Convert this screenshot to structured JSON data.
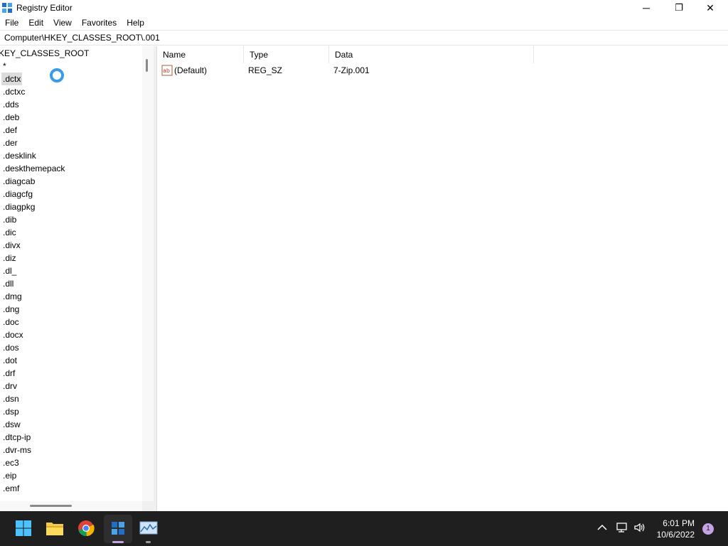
{
  "window": {
    "title": "Registry Editor",
    "icon": "registry-editor-icon",
    "controls": {
      "minimize": "─",
      "maximize": "❐",
      "close": "✕"
    }
  },
  "menu": {
    "items": [
      "File",
      "Edit",
      "View",
      "Favorites",
      "Help"
    ]
  },
  "address": {
    "path": "Computer\\HKEY_CLASSES_ROOT\\.001"
  },
  "tree": {
    "root": "KEY_CLASSES_ROOT",
    "items": [
      "*",
      ".dctx",
      ".dctxc",
      ".dds",
      ".deb",
      ".def",
      ".der",
      ".desklink",
      ".deskthemepack",
      ".diagcab",
      ".diagcfg",
      ".diagpkg",
      ".dib",
      ".dic",
      ".divx",
      ".diz",
      ".dl_",
      ".dll",
      ".dmg",
      ".dng",
      ".doc",
      ".docx",
      ".dos",
      ".dot",
      ".drf",
      ".drv",
      ".dsn",
      ".dsp",
      ".dsw",
      ".dtcp-ip",
      ".dvr-ms",
      ".ec3",
      ".eip",
      ".emf"
    ],
    "selected": ".dctx"
  },
  "values": {
    "columns": {
      "name": "Name",
      "type": "Type",
      "data": "Data"
    },
    "rows": [
      {
        "name": "(Default)",
        "type": "REG_SZ",
        "data": "7-Zip.001",
        "icon": "string-value-icon"
      }
    ]
  },
  "taskbar": {
    "apps": [
      "start-button",
      "file-explorer-icon",
      "chrome-icon",
      "registry-editor-icon",
      "resource-monitor-icon"
    ],
    "time": "6:01 PM",
    "date": "10/6/2022",
    "notification_count": "1"
  },
  "colors": {
    "accent": "#3a9be8",
    "taskbar": "#1f1f1f",
    "selection": "#dcdcdc"
  }
}
